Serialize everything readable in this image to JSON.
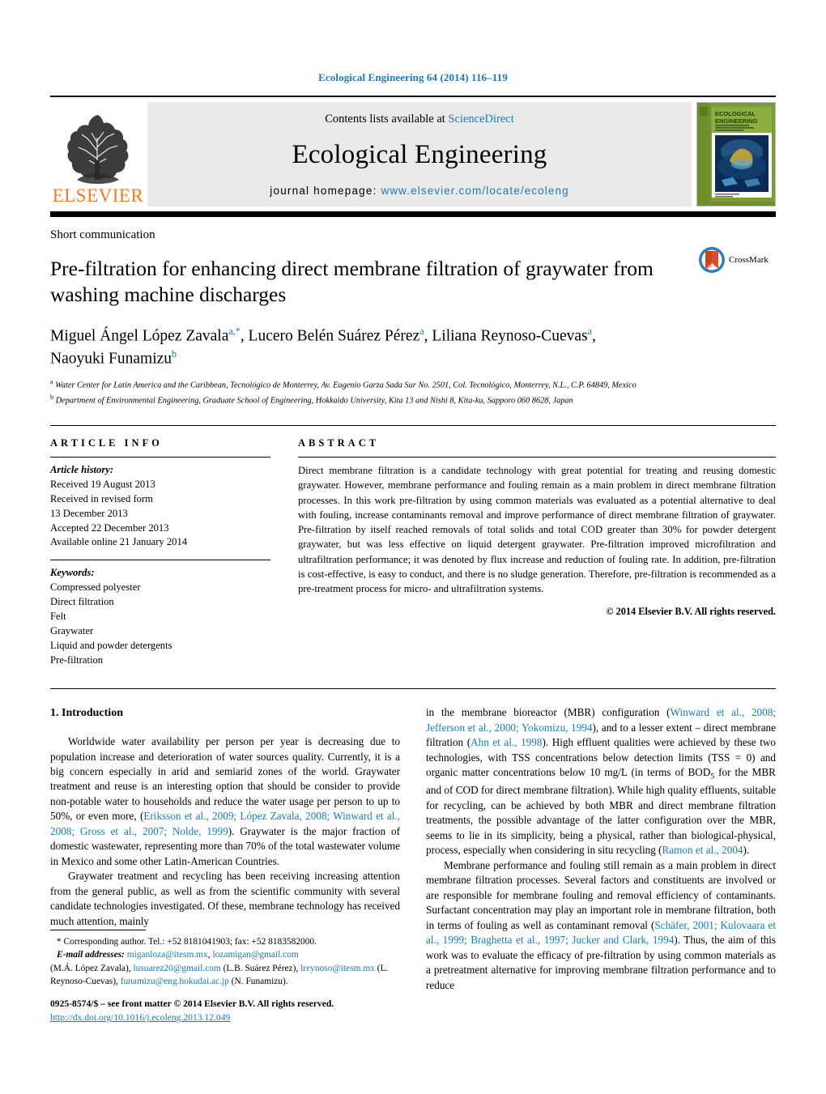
{
  "running_head": "Ecological Engineering 64 (2014) 116–119",
  "masthead": {
    "contents_prefix": "Contents lists available at ",
    "sciencedirect": "ScienceDirect",
    "journal_name": "Ecological Engineering",
    "homepage_prefix": "journal homepage: ",
    "homepage_url": "www.elsevier.com/locate/ecoleng",
    "publisher_wordmark": "ELSEVIER",
    "publisher_logo_icon": "elsevier-tree-icon",
    "cover_title_line1": "ECOLOGICAL",
    "cover_title_line2": "ENGINEERING"
  },
  "article": {
    "category": "Short communication",
    "title": "Pre-filtration for enhancing direct membrane filtration of graywater from washing machine discharges",
    "crossmark_label": "CrossMark",
    "authors_line1": "Miguel Ángel López Zavala",
    "authors_line1_mark": "a,*",
    "author2": "Lucero Belén Suárez Pérez",
    "author2_mark": "a",
    "author3": "Liliana Reynoso-Cuevas",
    "author3_mark": "a",
    "author4": "Naoyuki Funamizu",
    "author4_mark": "b",
    "affiliation_a": "Water Center for Latin America and the Caribbean, Tecnológico de Monterrey, Av. Eugenio Garza Sada Sur No. 2501, Col. Tecnológico, Monterrey, N.L., C.P. 64849, Mexico",
    "affiliation_b": "Department of Environmental Engineering, Graduate School of Engineering, Hokkaido University, Kita 13 and Nishi 8, Kita-ku, Sapporo 060 8628, Japan"
  },
  "article_info": {
    "heading": "ARTICLE INFO",
    "history_label": "Article history:",
    "history": [
      "Received 19 August 2013",
      "Received in revised form",
      "13 December 2013",
      "Accepted 22 December 2013",
      "Available online 21 January 2014"
    ],
    "keywords_label": "Keywords:",
    "keywords": [
      "Compressed polyester",
      "Direct filtration",
      "Felt",
      "Graywater",
      "Liquid and powder detergents",
      "Pre-filtration"
    ]
  },
  "abstract": {
    "heading": "ABSTRACT",
    "text": "Direct membrane filtration is a candidate technology with great potential for treating and reusing domestic graywater. However, membrane performance and fouling remain as a main problem in direct membrane filtration processes. In this work pre-filtration by using common materials was evaluated as a potential alternative to deal with fouling, increase contaminants removal and improve performance of direct membrane filtration of graywater. Pre-filtration by itself reached removals of total solids and total COD greater than 30% for powder detergent graywater, but was less effective on liquid detergent graywater. Pre-filtration improved microfiltration and ultrafiltration performance; it was denoted by flux increase and reduction of fouling rate. In addition, pre-filtration is cost-effective, is easy to conduct, and there is no sludge generation. Therefore, pre-filtration is recommended as a pre-treatment process for micro- and ultrafiltration systems.",
    "copyright": "© 2014 Elsevier B.V. All rights reserved."
  },
  "body": {
    "section_number_title": "1.  Introduction",
    "left_p1_a": "Worldwide water availability per person per year is decreasing due to population increase and deterioration of water sources quality. Currently, it is a big concern especially in arid and semiarid zones of the world. Graywater treatment and reuse is an interesting option that should be consider to provide non-potable water to households and reduce the water usage per person to up to 50%, or even more, (",
    "left_p1_cite": "Eriksson et al., 2009; López Zavala, 2008; Winward et al., 2008; Gross et al., 2007; Nolde, 1999",
    "left_p1_b": "). Graywater is the major fraction of domestic wastewater, representing more than 70% of the total wastewater volume in Mexico and some other Latin-American Countries.",
    "left_p2": "Graywater treatment and recycling has been receiving increasing attention from the general public, as well as from the scientific community with several candidate technologies investigated. Of these, membrane technology has received much attention, mainly",
    "right_p1_a": "in the membrane bioreactor (MBR) configuration (",
    "right_p1_cite1": "Winward et al., 2008; Jefferson et al., 2000; Yokomizu, 1994",
    "right_p1_b": "), and to a lesser extent – direct membrane filtration (",
    "right_p1_cite2": "Ahn et al., 1998",
    "right_p1_c": "). High effluent qualities were achieved by these two technologies, with TSS concentrations below detection limits (TSS = 0) and organic matter concentrations below 10 mg/L (in terms of BOD",
    "right_p1_sub": "5",
    "right_p1_d": " for the MBR and of COD for direct membrane filtration). While high quality effluents, suitable for recycling, can be achieved by both MBR and direct membrane filtration treatments, the possible advantage of the latter configuration over the MBR, seems to lie in its simplicity, being a physical, rather than biological-physical, process, especially when considering in situ recycling (",
    "right_p1_cite3": "Ramon et al., 2004",
    "right_p1_e": ").",
    "right_p2_a": "Membrane performance and fouling still remain as a main problem in direct membrane filtration processes. Several factors and constituents are involved or are responsible for membrane fouling and removal efficiency of contaminants. Surfactant concentration may play an important role in membrane filtration, both in terms of fouling as well as contaminant removal (",
    "right_p2_cite": "Schäfer, 2001; Kulovaara et al., 1999; Braghetta et al., 1997; Jucker and Clark, 1994",
    "right_p2_b": "). Thus, the aim of this work was to evaluate the efficacy of pre-filtration by using common materials as a pretreatment alternative for improving membrane filtration performance and to reduce"
  },
  "footnotes": {
    "corresponding": "* Corresponding author. Tel.: +52 8181041903; fax: +52 8183582000.",
    "email_label": "E-mail addresses:",
    "email1": "miganloza@itesm.mx",
    "email2": "lozamigan@gmail.com",
    "owner1": "(M.Á. López Zavala),",
    "email3": "lusuarez20@gmail.com",
    "owner2": "(L.B. Suárez Pérez),",
    "email4": "lreynoso@itesm.mx",
    "owner3": "(L. Reynoso-Cuevas),",
    "email5": "funamizu@eng.hokudai.ac.jp",
    "owner4": "(N. Funamizu)."
  },
  "imprint": {
    "issn_line": "0925-8574/$ – see front matter © 2014 Elsevier B.V. All rights reserved.",
    "doi": "http://dx.doi.org/10.1016/j.ecoleng.2013.12.049"
  },
  "colors": {
    "link": "#1a7bb9",
    "elsevier_orange": "#f47920",
    "masthead_bg": "#e9e9e9"
  }
}
